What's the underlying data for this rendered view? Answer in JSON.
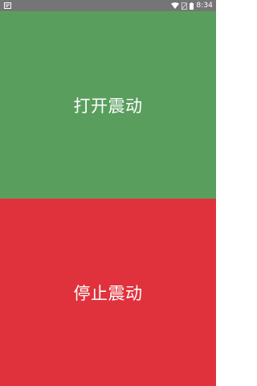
{
  "status_bar": {
    "time": "8:34",
    "icons": [
      "notification-icon",
      "wifi-icon",
      "no-sim-icon",
      "battery-icon"
    ]
  },
  "buttons": {
    "open_label": "打开震动",
    "stop_label": "停止震动"
  },
  "colors": {
    "status_bar": "#757575",
    "open_button": "#5a9e5e",
    "stop_button": "#e0323c",
    "label_text": "#ffffff"
  }
}
